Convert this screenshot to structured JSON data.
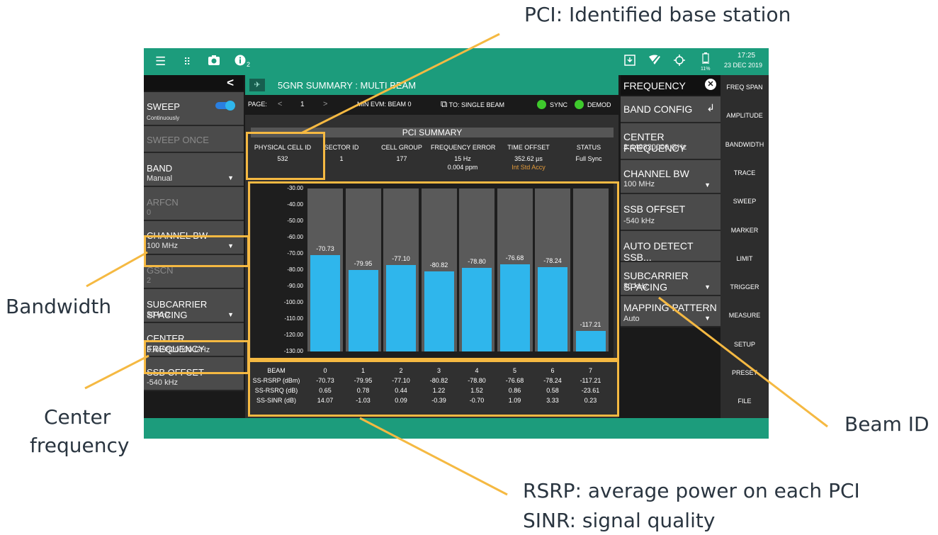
{
  "annotations": {
    "pci": "PCI: Identified base station",
    "bandwidth": "Bandwidth",
    "center_frequency_line1": "Center",
    "center_frequency_line2": "frequency",
    "beam_id": "Beam ID",
    "rsrp": "RSRP: average power on each PCI",
    "sinr": "SINR:  signal quality"
  },
  "topbar": {
    "menu_icon": "hamburger-icon",
    "apps_icon": "grid-icon",
    "camera_icon": "camera-icon",
    "info_icon": "info-icon",
    "info_count": "2",
    "time": "17:25",
    "date": "23 DEC 2019",
    "battery": "11%"
  },
  "left_panel": {
    "sweep_label": "SWEEP",
    "sweep_value": "Continuously",
    "sweep_once": "SWEEP ONCE",
    "band_label": "BAND",
    "band_value": "Manual",
    "arfcn_label": "ARFCN",
    "arfcn_value": "0",
    "channel_bw_label": "CHANNEL BW",
    "channel_bw_value": "100 MHz",
    "gscn_label": "GSCN",
    "gscn_value": "2",
    "subcarrier_label": "SUBCARRIER SPACING",
    "subcarrier_value": "30 kHz",
    "center_freq_label": "CENTER FREQUENCY",
    "center_freq_value": "3.449820000 GHz",
    "ssb_offset_label": "SSB OFFSET",
    "ssb_offset_value": "-540 kHz"
  },
  "main": {
    "title": "5GNR SUMMARY : MULTI BEAM",
    "page_label": "PAGE:",
    "page_value": "1",
    "min_evm": "MIN EVM: BEAM 0",
    "to_single": "TO: SINGLE BEAM",
    "sync": "SYNC",
    "demod": "DEMOD",
    "pci_summary": "PCI SUMMARY",
    "headers": [
      "PHYSICAL CELL ID",
      "SECTOR ID",
      "CELL GROUP",
      "FREQUENCY ERROR",
      "TIME OFFSET",
      "STATUS"
    ],
    "values": [
      "532",
      "1",
      "177",
      "15 Hz",
      "352.62 µs",
      "Full Sync"
    ],
    "freq_error_ppm": "0.004 ppm",
    "time_offset_note": "Int Std Accy",
    "table": {
      "row_labels": [
        "BEAM",
        "SS-RSRP (dBm)",
        "SS-RSRQ (dB)",
        "SS-SINR (dB)"
      ],
      "beam": [
        "0",
        "1",
        "2",
        "3",
        "4",
        "5",
        "6",
        "7"
      ],
      "rsrp": [
        "-70.73",
        "-79.95",
        "-77.10",
        "-80.82",
        "-78.80",
        "-76.68",
        "-78.24",
        "-117.21"
      ],
      "rsrq": [
        "0.65",
        "0.78",
        "0.44",
        "1.22",
        "1.52",
        "0.86",
        "0.58",
        "-23.61"
      ],
      "sinr": [
        "14.07",
        "-1.03",
        "0.09",
        "-0.39",
        "-0.70",
        "1.09",
        "3.33",
        "0.23"
      ]
    }
  },
  "chart_data": {
    "type": "bar",
    "categories": [
      "0",
      "1",
      "2",
      "3",
      "4",
      "5",
      "6",
      "7"
    ],
    "values": [
      -70.73,
      -79.95,
      -77.1,
      -80.82,
      -78.8,
      -76.68,
      -78.24,
      -117.21
    ],
    "ylim": [
      -130,
      -30
    ],
    "yticks": [
      "-30.00",
      "-40.00",
      "-50.00",
      "-60.00",
      "-70.00",
      "-80.00",
      "-90.00",
      "-100.00",
      "-110.00",
      "-120.00",
      "-130.00"
    ],
    "bar_color": "#2fb6ec"
  },
  "right_panel": {
    "title": "FREQUENCY",
    "band_config": "BAND CONFIG",
    "center_freq_label": "CENTER FREQUENCY",
    "center_freq_value": "3.449820000 GHz",
    "channel_bw_label": "CHANNEL BW",
    "channel_bw_value": "100 MHz",
    "ssb_offset_label": "SSB OFFSET",
    "ssb_offset_value": "-540 kHz",
    "auto_detect": "AUTO DETECT SSB...",
    "subcarrier_label": "SUBCARRIER SPACING",
    "subcarrier_value": "30 kHz",
    "mapping_label": "MAPPING PATTERN",
    "mapping_value": "Auto"
  },
  "right_strip": [
    "FREQ SPAN",
    "AMPLITUDE",
    "BANDWIDTH",
    "TRACE",
    "SWEEP",
    "MARKER",
    "LIMIT",
    "TRIGGER",
    "MEASURE",
    "SETUP",
    "PRESET",
    "FILE"
  ],
  "colors": {
    "accent": "#1c9c7c",
    "highlight": "#f5b942",
    "bar": "#2fb6ec"
  }
}
